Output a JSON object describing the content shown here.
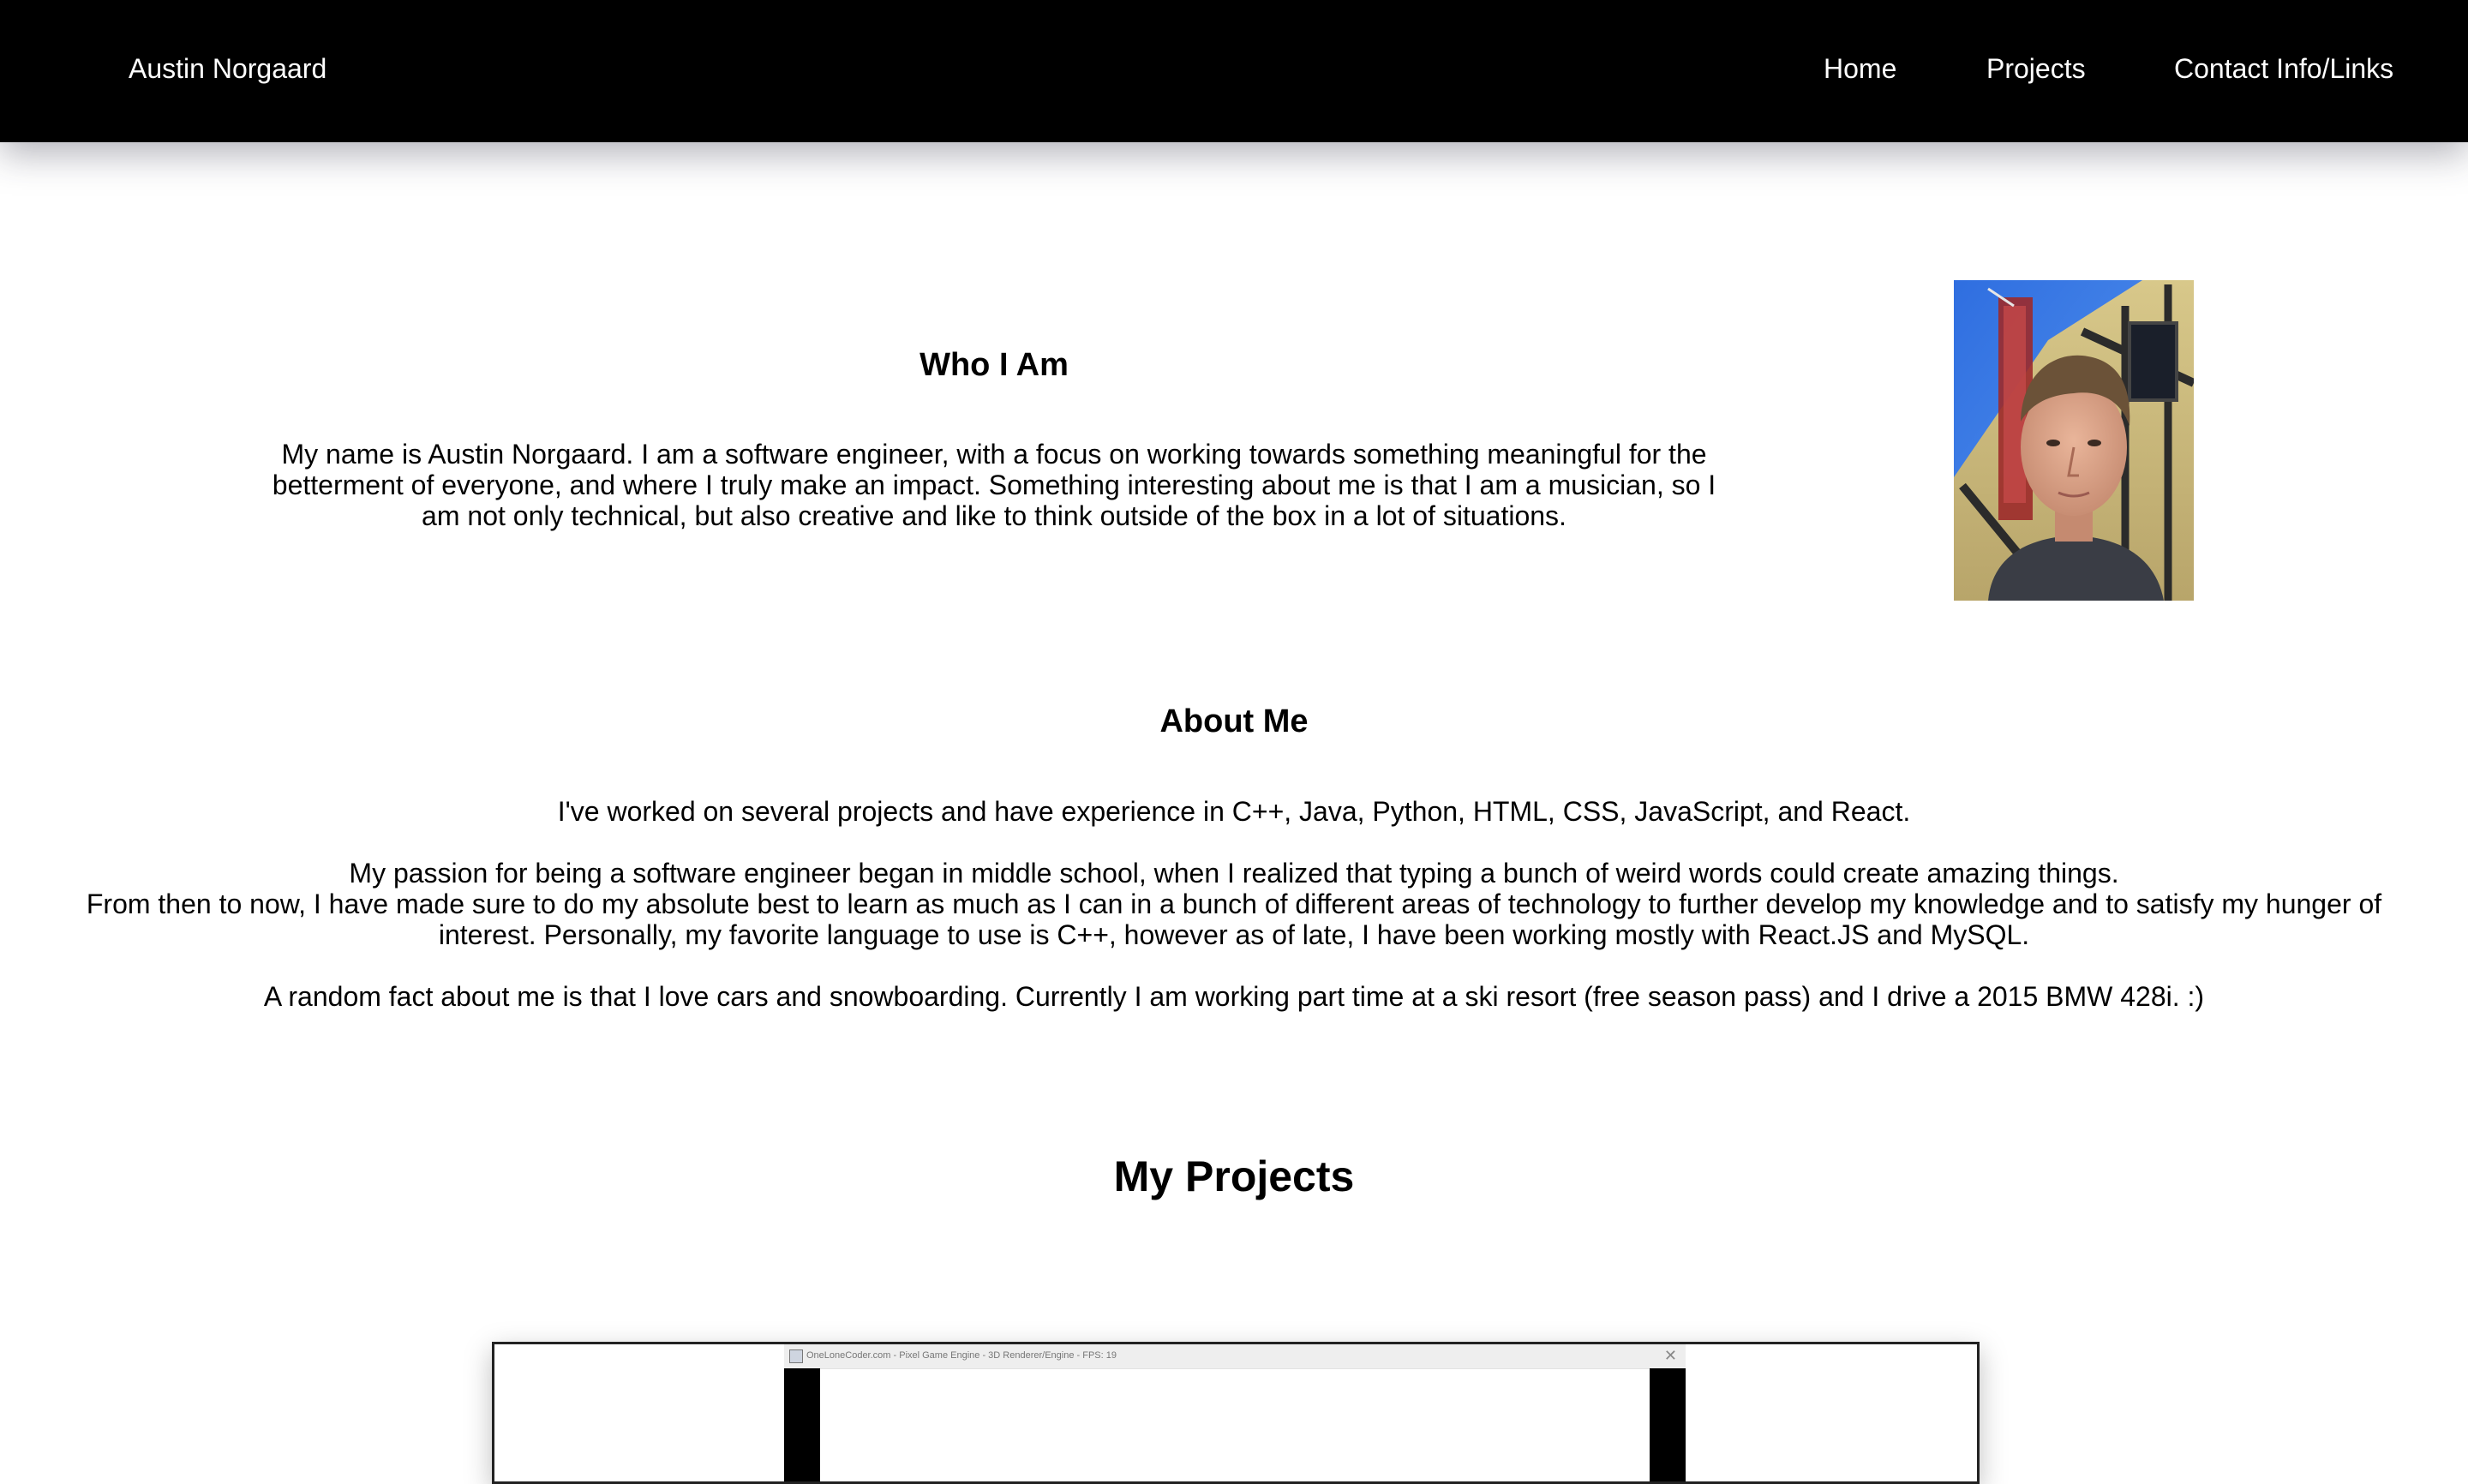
{
  "navbar": {
    "brand": "Austin Norgaard",
    "links": [
      {
        "label": "Home"
      },
      {
        "label": "Projects"
      },
      {
        "label": "Contact Info/Links"
      }
    ]
  },
  "who": {
    "title": "Who I Am",
    "text": "My name is Austin Norgaard. I am a software engineer, with a focus on working towards something meaningful for the betterment of everyone, and where I truly make an impact. Something interesting about me is that I am a musician, so I am not only technical, but also creative and like to think outside of the box in a lot of situations."
  },
  "about": {
    "title": "About Me",
    "p1": "I've worked on several projects and have experience in C++, Java, Python, HTML, CSS, JavaScript, and React.",
    "p2_line1": "My passion for being a software engineer began in middle school, when I realized that typing a bunch of weird words could create amazing things.",
    "p2_line2": "From then to now, I have made sure to do my absolute best to learn as much as I can in a bunch of different areas of technology to further develop my knowledge and to satisfy my hunger of interest. Personally, my favorite language to use is C++, however as of late, I have been working mostly with React.JS and MySQL.",
    "p3": "A random fact about me is that I love cars and snowboarding. Currently I am working part time at a ski resort (free season pass) and I drive a 2015 BMW 428i. :)"
  },
  "projects": {
    "title": "My Projects",
    "first_preview": {
      "window_title": "OneLoneCoder.com - Pixel Game Engine - 3D Renderer/Engine - FPS: 19",
      "close_icon": "close-icon"
    }
  },
  "colors": {
    "navbar_bg": "#000000",
    "navbar_text": "#ffffff",
    "page_bg": "#ffffff",
    "text": "#000000"
  }
}
